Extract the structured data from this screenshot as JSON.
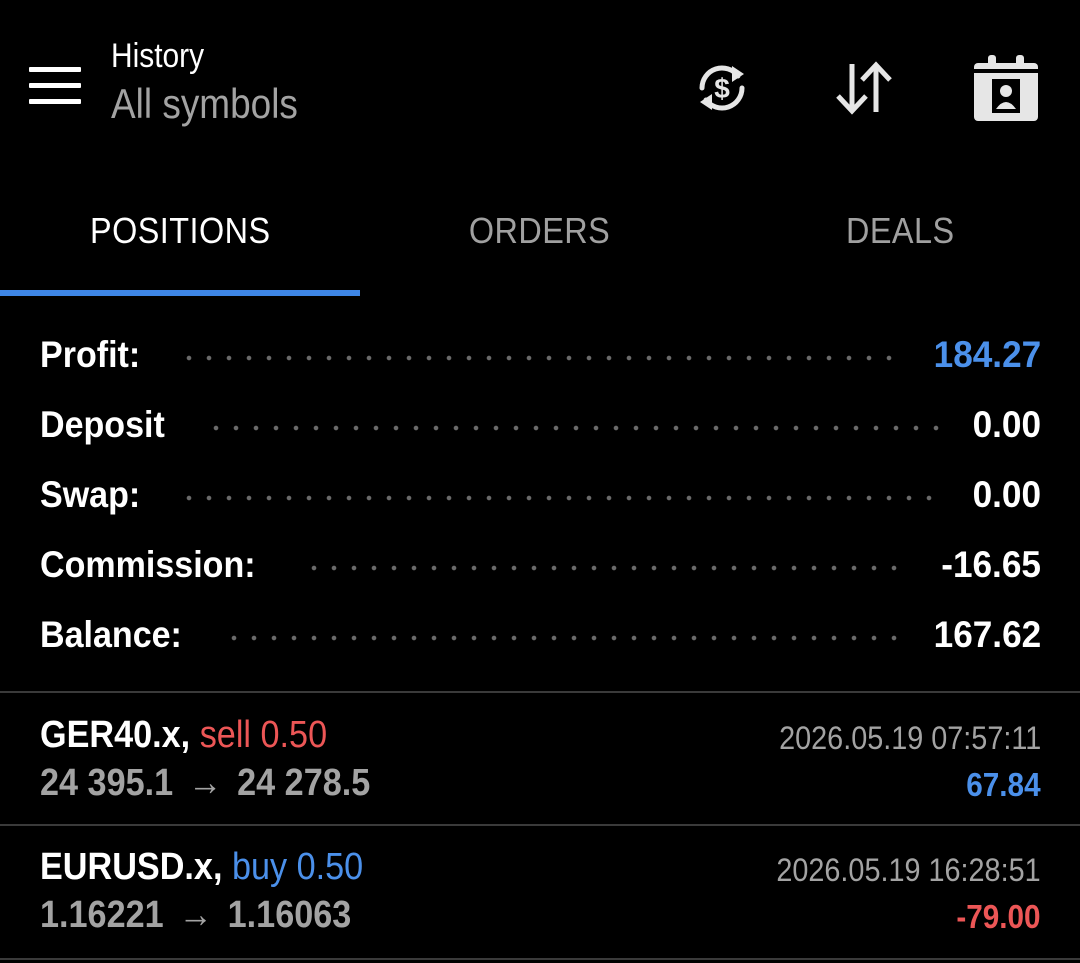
{
  "header": {
    "title": "History",
    "subtitle": "All symbols",
    "icons": {
      "menu": "hamburger-menu-icon",
      "currency": "currency-exchange-icon",
      "sort": "sort-icon",
      "calendar": "calendar-icon"
    }
  },
  "tabs": [
    {
      "label": "POSITIONS",
      "active": true
    },
    {
      "label": "ORDERS",
      "active": false
    },
    {
      "label": "DEALS",
      "active": false
    }
  ],
  "summary": {
    "profit": {
      "label": "Profit:",
      "value": "184.27"
    },
    "deposit": {
      "label": "Deposit",
      "value": "0.00"
    },
    "swap": {
      "label": "Swap:",
      "value": "0.00"
    },
    "commission": {
      "label": "Commission:",
      "value": "-16.65"
    },
    "balance": {
      "label": "Balance:",
      "value": "167.62"
    }
  },
  "positions": [
    {
      "symbol": "GER40.x",
      "side": "sell",
      "volume": "0.50",
      "open_price": "24 395.1",
      "close_price": "24 278.5",
      "time": "2026.05.19 07:57:11",
      "profit": "67.84"
    },
    {
      "symbol": "EURUSD.x",
      "side": "buy",
      "volume": "0.50",
      "open_price": "1.16221",
      "close_price": "1.16063",
      "time": "2026.05.19 16:28:51",
      "profit": "-79.00"
    }
  ],
  "colors": {
    "background": "#000000",
    "accent_blue": "#4b90ea",
    "tab_indicator": "#3e86e6",
    "loss_red": "#ec5656",
    "muted_text": "#a3a3a3"
  }
}
